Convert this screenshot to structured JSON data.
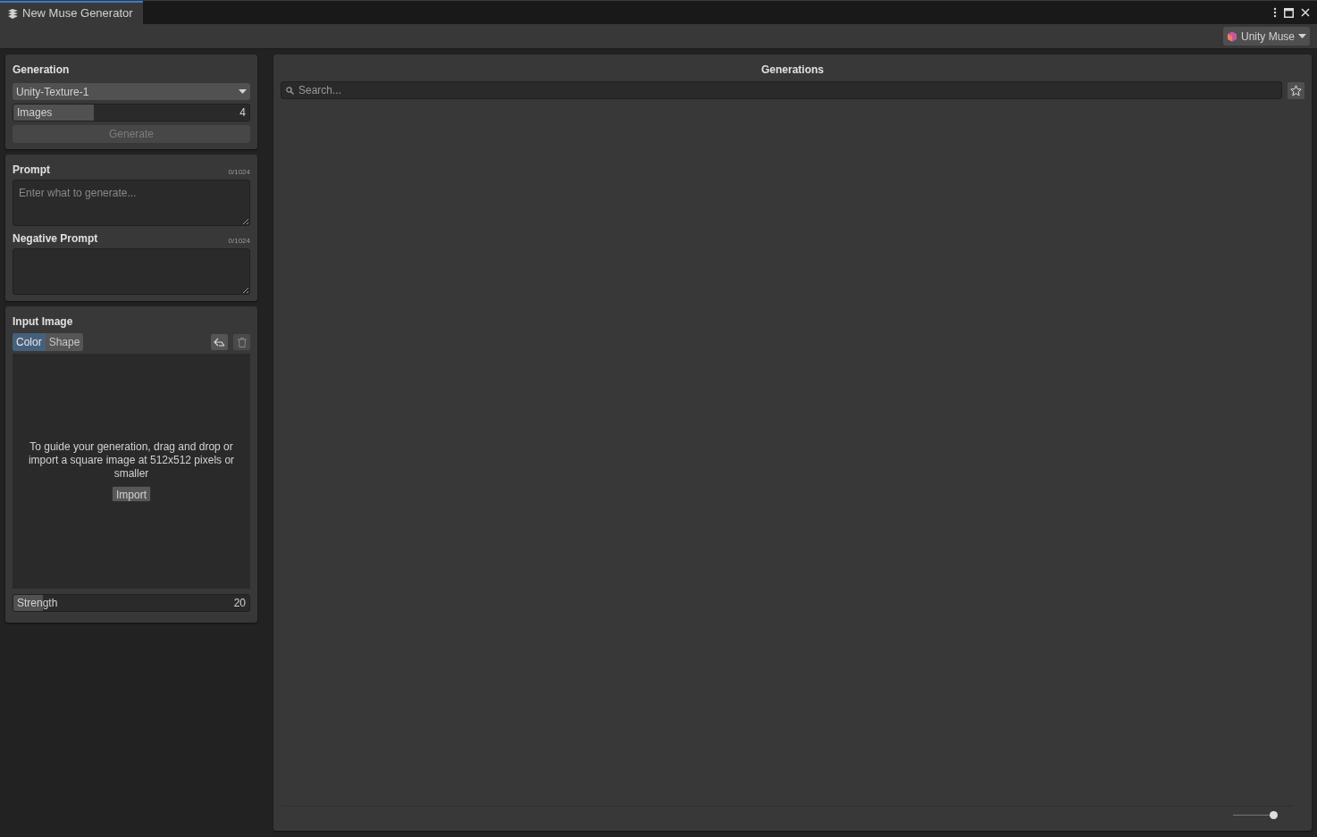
{
  "window": {
    "tab_title": "New Muse Generator"
  },
  "toolbar": {
    "account_button": "Unity Muse"
  },
  "generation": {
    "title": "Generation",
    "model": "Unity-Texture-1",
    "images": {
      "label": "Images",
      "value": "4",
      "level": 0.34
    },
    "generate_button": {
      "label": "Generate",
      "disabled": true
    }
  },
  "prompt": {
    "title": "Prompt",
    "counter": "0/1024",
    "placeholder": "Enter what to generate..."
  },
  "negative_prompt": {
    "title": "Negative Prompt",
    "counter": "0/1024"
  },
  "input_image": {
    "title": "Input Image",
    "tabs": [
      {
        "label": "Color",
        "selected": true
      },
      {
        "label": "Shape",
        "selected": false
      }
    ],
    "hint": "To guide your generation, drag and drop or import a square image at 512x512 pixels or smaller",
    "import_button": "Import",
    "strength": {
      "label": "Strength",
      "value": "20",
      "level": 0.125
    }
  },
  "generations": {
    "title": "Generations",
    "search_placeholder": "Search...",
    "size_slider": {
      "level": 1
    }
  }
}
